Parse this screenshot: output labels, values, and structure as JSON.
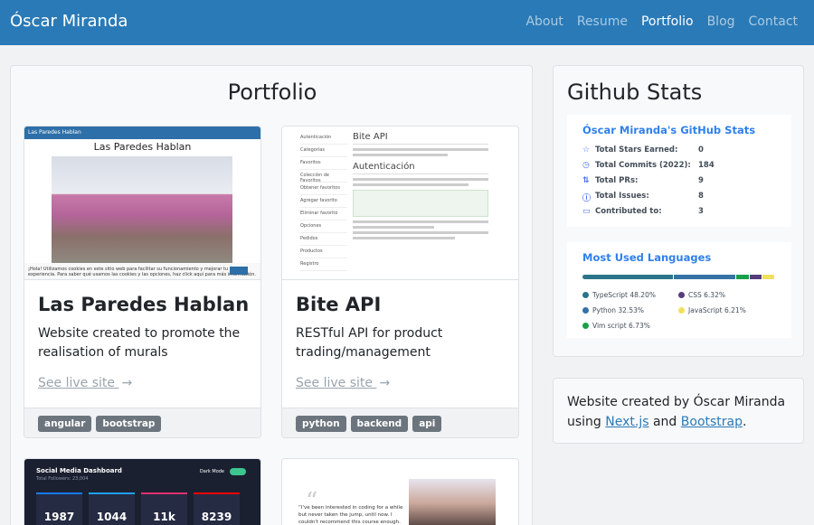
{
  "navbar": {
    "brand": "Óscar Miranda",
    "links": [
      {
        "label": "About",
        "active": false
      },
      {
        "label": "Resume",
        "active": false
      },
      {
        "label": "Portfolio",
        "active": true
      },
      {
        "label": "Blog",
        "active": false
      },
      {
        "label": "Contact",
        "active": false
      }
    ]
  },
  "portfolio": {
    "title": "Portfolio",
    "projects": [
      {
        "title": "Las Paredes Hablan",
        "description": "Website created to promote the realisation of murals",
        "link_label": "See live site",
        "tags": [
          "angular",
          "bootstrap"
        ],
        "preview": {
          "heading": "Las Paredes Hablan",
          "nav_brand": "Las Paredes Hablan",
          "cookie_text": "¡Hola! Utilizamos cookies en este sitio web para facilitar su funcionamiento y mejorar tu experiencia. Para saber qué usamos las cookies y las opciones, haz click aquí para más información."
        }
      },
      {
        "title": "Bite API",
        "description": "RESTful API for product trading/management",
        "link_label": "See live site",
        "tags": [
          "python",
          "backend",
          "api"
        ],
        "preview": {
          "heading": "Bite API",
          "section": "Autenticación",
          "sidebar": [
            "Autenticación",
            "Categorías",
            "Favoritos",
            "Colección de Favoritos",
            "Obtener favoritos",
            "Agregar favorito",
            "Eliminar favorito",
            "Opciones",
            "Pedidos",
            "Productos",
            "Registro"
          ]
        }
      },
      {
        "preview": {
          "title": "Social Media Dashboard",
          "subtitle": "Total Followers: 23,004",
          "dark_mode": "Dark Mode",
          "counts": [
            "1987",
            "1044",
            "11k",
            "8239"
          ]
        }
      },
      {
        "preview": {
          "quote_mark": "“",
          "quote": "“I've been interested in coding for a while but never taken the jump, until now. I couldn't recommend this course enough. I'm now in the"
        }
      }
    ]
  },
  "github": {
    "title": "Github Stats",
    "stats_card": {
      "title": "Óscar Miranda's GitHub Stats",
      "rows": [
        {
          "icon": "star-icon",
          "glyph": "☆",
          "label": "Total Stars Earned:",
          "value": "0"
        },
        {
          "icon": "history-icon",
          "glyph": "◷",
          "label": "Total Commits (2022):",
          "value": "184"
        },
        {
          "icon": "pull-request-icon",
          "glyph": "⇅",
          "label": "Total PRs:",
          "value": "9"
        },
        {
          "icon": "issue-icon",
          "glyph": "ⓘ",
          "label": "Total Issues:",
          "value": "8"
        },
        {
          "icon": "repo-icon",
          "glyph": "▭",
          "label": "Contributed to:",
          "value": "3"
        }
      ]
    },
    "languages_card": {
      "title": "Most Used Languages",
      "languages": [
        {
          "name": "TypeScript",
          "percent": "48.20%",
          "value": 48.2,
          "color": "#2b7489"
        },
        {
          "name": "CSS",
          "percent": "6.32%",
          "value": 6.32,
          "color": "#563d7c"
        },
        {
          "name": "Python",
          "percent": "32.53%",
          "value": 32.53,
          "color": "#3572a5"
        },
        {
          "name": "JavaScript",
          "percent": "6.21%",
          "value": 6.21,
          "color": "#f1e05a"
        },
        {
          "name": "Vim script",
          "percent": "6.73%",
          "value": 6.73,
          "color": "#199f4b"
        }
      ]
    }
  },
  "credit": {
    "text_before": "Website created by Óscar Miranda using ",
    "link1": "Next.js",
    "text_middle": " and ",
    "link2": "Bootstrap",
    "text_after": "."
  },
  "colors": {
    "navbar": "#2a7ab7",
    "tag": "#6c757d",
    "link": "#2a7ab7"
  }
}
